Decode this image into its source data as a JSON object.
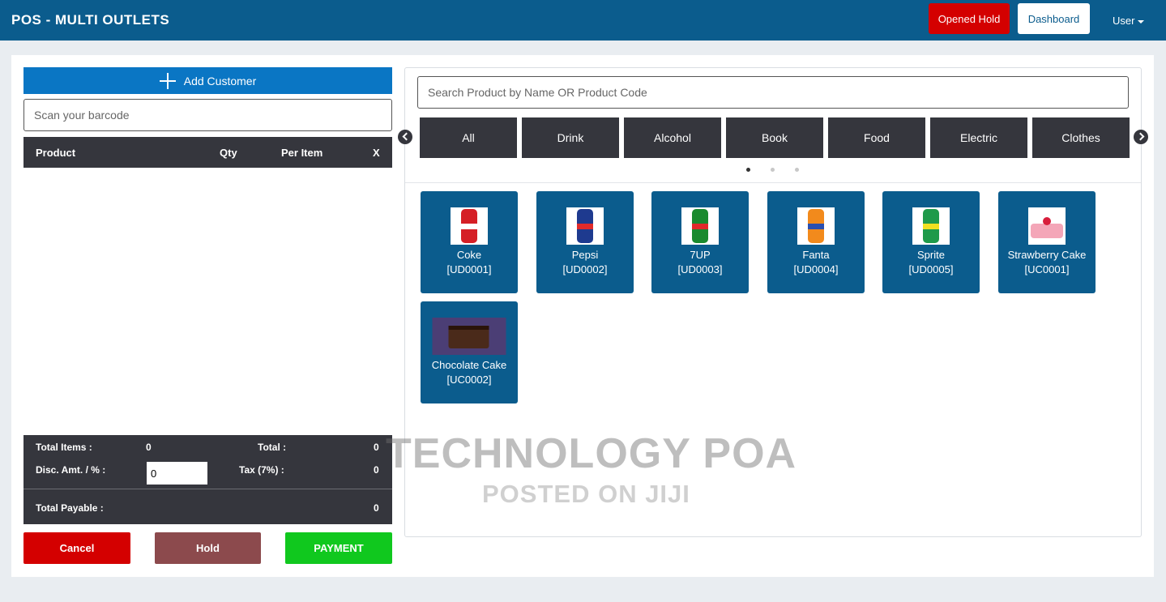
{
  "header": {
    "title": "POS - MULTI OUTLETS",
    "opened_hold": "Opened Hold",
    "dashboard": "Dashboard",
    "user": "User"
  },
  "left": {
    "add_customer": "Add Customer",
    "barcode_placeholder": "Scan your barcode",
    "table_headers": [
      "Product",
      "Qty",
      "Per Item",
      "X"
    ],
    "totals": {
      "total_items_label": "Total Items :",
      "total_items_value": "0",
      "total_label": "Total :",
      "total_value": "0",
      "disc_label": "Disc. Amt. / % :",
      "disc_value": "0",
      "tax_label": "Tax (7%) :",
      "tax_value": "0",
      "payable_label": "Total Payable :",
      "payable_value": "0"
    },
    "buttons": {
      "cancel": "Cancel",
      "hold": "Hold",
      "payment": "PAYMENT"
    }
  },
  "right": {
    "search_placeholder": "Search Product by Name OR Product Code",
    "categories": [
      "All",
      "Drink",
      "Alcohol",
      "Book",
      "Food",
      "Electric",
      "Clothes"
    ],
    "carousel_pages": 3,
    "carousel_active": 0,
    "products": [
      {
        "name": "Coke",
        "code": "[UD0001]",
        "icon": "coke-can-icon",
        "color": "#d51f26"
      },
      {
        "name": "Pepsi",
        "code": "[UD0002]",
        "icon": "pepsi-can-icon",
        "color": "#1e3a8f"
      },
      {
        "name": "7UP",
        "code": "[UD0003]",
        "icon": "7up-can-icon",
        "color": "#1a8a2e"
      },
      {
        "name": "Fanta",
        "code": "[UD0004]",
        "icon": "fanta-can-icon",
        "color": "#f28a1c"
      },
      {
        "name": "Sprite",
        "code": "[UD0005]",
        "icon": "sprite-can-icon",
        "color": "#1f9a4a"
      },
      {
        "name": "Strawberry Cake",
        "code": "[UC0001]",
        "icon": "strawberry-cake-icon",
        "color": "#f4a6b8"
      },
      {
        "name": "Chocolate Cake",
        "code": "[UC0002]",
        "icon": "chocolate-cake-icon",
        "color": "#4a2a1a"
      }
    ]
  },
  "watermark": {
    "line1": "TECHNOLOGY POA",
    "line2": "POSTED ON JIJI"
  },
  "colors": {
    "header_bg": "#0b5c8d",
    "primary_blue": "#0a76c4",
    "danger": "#d40000",
    "success": "#10c81e",
    "dark": "#35363d"
  }
}
